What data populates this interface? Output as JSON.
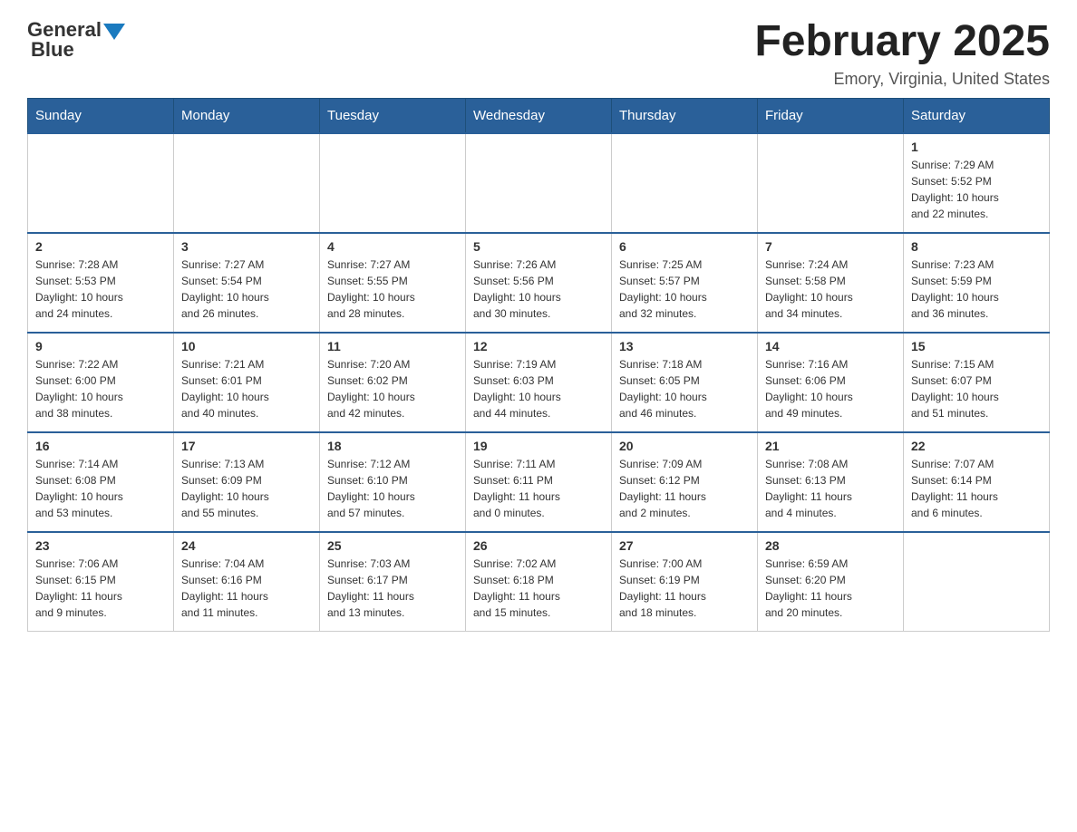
{
  "header": {
    "logo_general": "General",
    "logo_blue": "Blue",
    "main_title": "February 2025",
    "subtitle": "Emory, Virginia, United States"
  },
  "days_of_week": [
    "Sunday",
    "Monday",
    "Tuesday",
    "Wednesday",
    "Thursday",
    "Friday",
    "Saturday"
  ],
  "weeks": [
    [
      {
        "day": "",
        "info": ""
      },
      {
        "day": "",
        "info": ""
      },
      {
        "day": "",
        "info": ""
      },
      {
        "day": "",
        "info": ""
      },
      {
        "day": "",
        "info": ""
      },
      {
        "day": "",
        "info": ""
      },
      {
        "day": "1",
        "info": "Sunrise: 7:29 AM\nSunset: 5:52 PM\nDaylight: 10 hours\nand 22 minutes."
      }
    ],
    [
      {
        "day": "2",
        "info": "Sunrise: 7:28 AM\nSunset: 5:53 PM\nDaylight: 10 hours\nand 24 minutes."
      },
      {
        "day": "3",
        "info": "Sunrise: 7:27 AM\nSunset: 5:54 PM\nDaylight: 10 hours\nand 26 minutes."
      },
      {
        "day": "4",
        "info": "Sunrise: 7:27 AM\nSunset: 5:55 PM\nDaylight: 10 hours\nand 28 minutes."
      },
      {
        "day": "5",
        "info": "Sunrise: 7:26 AM\nSunset: 5:56 PM\nDaylight: 10 hours\nand 30 minutes."
      },
      {
        "day": "6",
        "info": "Sunrise: 7:25 AM\nSunset: 5:57 PM\nDaylight: 10 hours\nand 32 minutes."
      },
      {
        "day": "7",
        "info": "Sunrise: 7:24 AM\nSunset: 5:58 PM\nDaylight: 10 hours\nand 34 minutes."
      },
      {
        "day": "8",
        "info": "Sunrise: 7:23 AM\nSunset: 5:59 PM\nDaylight: 10 hours\nand 36 minutes."
      }
    ],
    [
      {
        "day": "9",
        "info": "Sunrise: 7:22 AM\nSunset: 6:00 PM\nDaylight: 10 hours\nand 38 minutes."
      },
      {
        "day": "10",
        "info": "Sunrise: 7:21 AM\nSunset: 6:01 PM\nDaylight: 10 hours\nand 40 minutes."
      },
      {
        "day": "11",
        "info": "Sunrise: 7:20 AM\nSunset: 6:02 PM\nDaylight: 10 hours\nand 42 minutes."
      },
      {
        "day": "12",
        "info": "Sunrise: 7:19 AM\nSunset: 6:03 PM\nDaylight: 10 hours\nand 44 minutes."
      },
      {
        "day": "13",
        "info": "Sunrise: 7:18 AM\nSunset: 6:05 PM\nDaylight: 10 hours\nand 46 minutes."
      },
      {
        "day": "14",
        "info": "Sunrise: 7:16 AM\nSunset: 6:06 PM\nDaylight: 10 hours\nand 49 minutes."
      },
      {
        "day": "15",
        "info": "Sunrise: 7:15 AM\nSunset: 6:07 PM\nDaylight: 10 hours\nand 51 minutes."
      }
    ],
    [
      {
        "day": "16",
        "info": "Sunrise: 7:14 AM\nSunset: 6:08 PM\nDaylight: 10 hours\nand 53 minutes."
      },
      {
        "day": "17",
        "info": "Sunrise: 7:13 AM\nSunset: 6:09 PM\nDaylight: 10 hours\nand 55 minutes."
      },
      {
        "day": "18",
        "info": "Sunrise: 7:12 AM\nSunset: 6:10 PM\nDaylight: 10 hours\nand 57 minutes."
      },
      {
        "day": "19",
        "info": "Sunrise: 7:11 AM\nSunset: 6:11 PM\nDaylight: 11 hours\nand 0 minutes."
      },
      {
        "day": "20",
        "info": "Sunrise: 7:09 AM\nSunset: 6:12 PM\nDaylight: 11 hours\nand 2 minutes."
      },
      {
        "day": "21",
        "info": "Sunrise: 7:08 AM\nSunset: 6:13 PM\nDaylight: 11 hours\nand 4 minutes."
      },
      {
        "day": "22",
        "info": "Sunrise: 7:07 AM\nSunset: 6:14 PM\nDaylight: 11 hours\nand 6 minutes."
      }
    ],
    [
      {
        "day": "23",
        "info": "Sunrise: 7:06 AM\nSunset: 6:15 PM\nDaylight: 11 hours\nand 9 minutes."
      },
      {
        "day": "24",
        "info": "Sunrise: 7:04 AM\nSunset: 6:16 PM\nDaylight: 11 hours\nand 11 minutes."
      },
      {
        "day": "25",
        "info": "Sunrise: 7:03 AM\nSunset: 6:17 PM\nDaylight: 11 hours\nand 13 minutes."
      },
      {
        "day": "26",
        "info": "Sunrise: 7:02 AM\nSunset: 6:18 PM\nDaylight: 11 hours\nand 15 minutes."
      },
      {
        "day": "27",
        "info": "Sunrise: 7:00 AM\nSunset: 6:19 PM\nDaylight: 11 hours\nand 18 minutes."
      },
      {
        "day": "28",
        "info": "Sunrise: 6:59 AM\nSunset: 6:20 PM\nDaylight: 11 hours\nand 20 minutes."
      },
      {
        "day": "",
        "info": ""
      }
    ]
  ]
}
